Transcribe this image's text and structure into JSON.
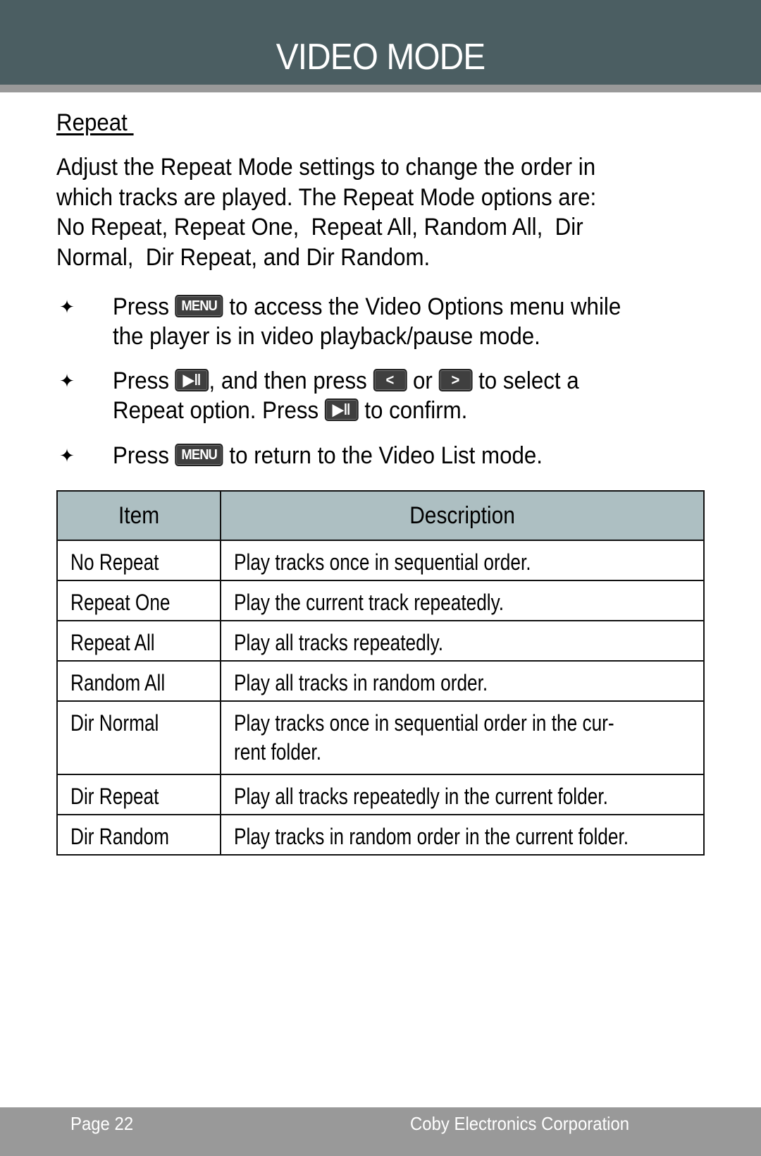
{
  "header": {
    "title": "VIDEO MODE"
  },
  "section": {
    "heading": "Repeat ",
    "intro_lines": [
      "Adjust the Repeat Mode settings to change the order in",
      "which tracks are played. The Repeat Mode options are:",
      "No Repeat, Repeat One,  Repeat All, Random All,  Dir",
      "Normal,  Dir Repeat, and Dir Random."
    ]
  },
  "keys": {
    "menu": "MENU",
    "play_pause": "▶‖",
    "left": "<",
    "right": ">"
  },
  "bullets": {
    "b1": {
      "t1": "Press ",
      "t2": " to access the Video Options menu while",
      "line2": "the player is in video playback/pause mode."
    },
    "b2": {
      "t1": "Press ",
      "t2": ", and then press ",
      "t3": " or ",
      "t4": " to select a",
      "line2a": "Repeat option. Press ",
      "line2b": " to confirm."
    },
    "b3": {
      "t1": "Press ",
      "t2": " to return to the Video List mode."
    }
  },
  "table": {
    "headers": {
      "item": "Item",
      "description": "Description"
    },
    "rows": [
      {
        "item": "No Repeat",
        "description": "Play tracks once in sequential order."
      },
      {
        "item": "Repeat One",
        "description": "Play the current track repeatedly."
      },
      {
        "item": "Repeat All",
        "description": "Play all tracks repeatedly."
      },
      {
        "item": "Random All",
        "description": "Play all tracks in random order."
      },
      {
        "item": "Dir Normal",
        "description": "Play tracks once in sequential order in the cur-",
        "description2": "rent folder."
      },
      {
        "item": "Dir Repeat",
        "description": "Play all tracks repeatedly in the current folder."
      },
      {
        "item": "Dir Random",
        "description": "Play tracks in random order in the current folder."
      }
    ]
  },
  "footer": {
    "page": "Page 22",
    "company": "Coby Electronics Corporation"
  }
}
